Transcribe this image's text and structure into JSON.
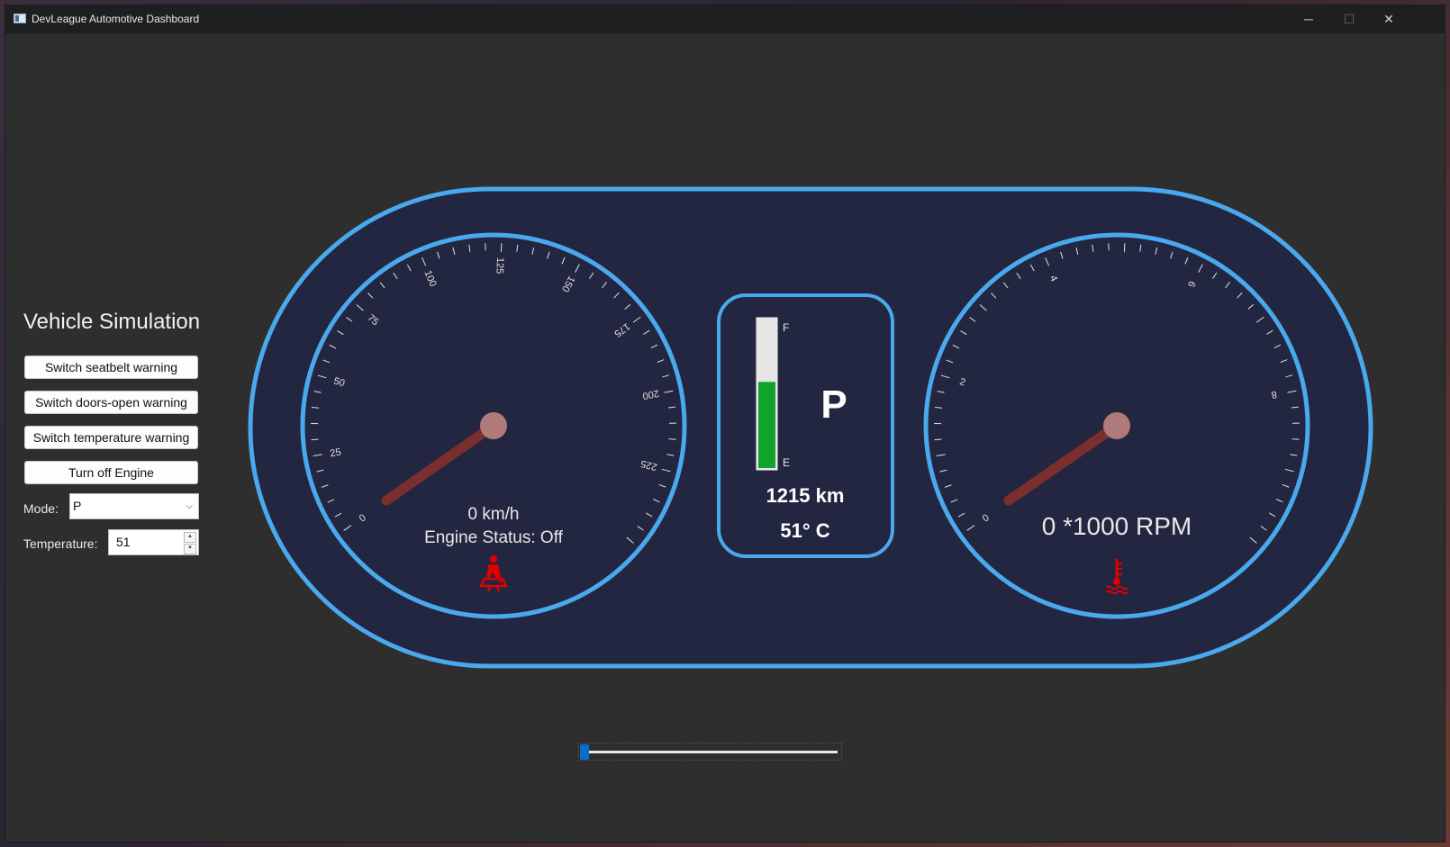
{
  "window": {
    "title": "DevLeague Automotive Dashboard",
    "min_glyph": "─",
    "max_glyph": "☐",
    "close_glyph": "✕"
  },
  "sidebar": {
    "title": "Vehicle Simulation",
    "buttons": [
      {
        "label": "Switch seatbelt warning"
      },
      {
        "label": "Switch doors-open warning"
      },
      {
        "label": "Switch temperature warning"
      },
      {
        "label": "Turn off Engine"
      }
    ],
    "mode_label": "Mode:",
    "mode_value": "P",
    "temperature_label": "Temperature:",
    "temperature_value": "51"
  },
  "speedometer": {
    "ticks": [
      "0",
      "25",
      "50",
      "75",
      "100",
      "125",
      "150",
      "175",
      "200",
      "225"
    ],
    "max": 250,
    "value": 0,
    "speed_text": "0 km/h",
    "engine_status": "Engine Status: Off",
    "warning_icon": "seatbelt-warning-icon"
  },
  "center": {
    "fuel_full": "F",
    "fuel_empty": "E",
    "fuel_fraction": 0.58,
    "gear": "P",
    "range": "1215 km",
    "temperature": "51° C"
  },
  "tachometer": {
    "ticks": [
      "0",
      "2",
      "4",
      "6",
      "8"
    ],
    "max": 10,
    "value": 0,
    "rpm_text": "0 *1000 RPM",
    "warning_icon": "coolant-temperature-warning-icon"
  },
  "slider": {
    "value": 0
  },
  "colors": {
    "accent": "#4aa8ec",
    "panel": "#232640",
    "needle": "#7b2e2e",
    "warning": "#e00000",
    "fuel": "#11a32a"
  }
}
